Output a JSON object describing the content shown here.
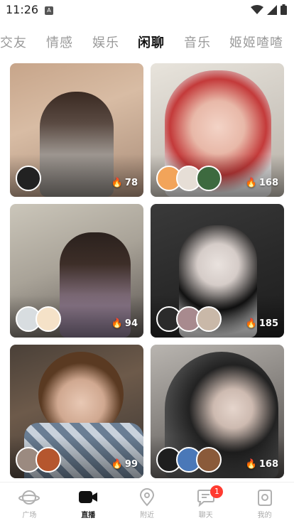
{
  "status_bar": {
    "time": "11:26"
  },
  "tabs": [
    {
      "label": "交友",
      "active": false
    },
    {
      "label": "情感",
      "active": false
    },
    {
      "label": "娱乐",
      "active": false
    },
    {
      "label": "闲聊",
      "active": true
    },
    {
      "label": "音乐",
      "active": false
    },
    {
      "label": "姬姬喳喳",
      "active": false
    }
  ],
  "rooms": [
    {
      "viewers": "78"
    },
    {
      "viewers": "168"
    },
    {
      "viewers": "94"
    },
    {
      "viewers": "185"
    },
    {
      "viewers": "99"
    },
    {
      "viewers": "168"
    }
  ],
  "bottom_nav": [
    {
      "label": "广场",
      "icon": "planet-icon",
      "active": false
    },
    {
      "label": "直播",
      "icon": "video-camera-icon",
      "active": true
    },
    {
      "label": "附近",
      "icon": "location-pin-icon",
      "active": false
    },
    {
      "label": "聊天",
      "icon": "chat-bubble-icon",
      "active": false,
      "badge": "1"
    },
    {
      "label": "我的",
      "icon": "profile-icon",
      "active": false
    }
  ],
  "colors": {
    "accent": "#ff6a00",
    "badge": "#ff3b30",
    "active_text": "#111111",
    "inactive_text": "#9a9a9a"
  }
}
